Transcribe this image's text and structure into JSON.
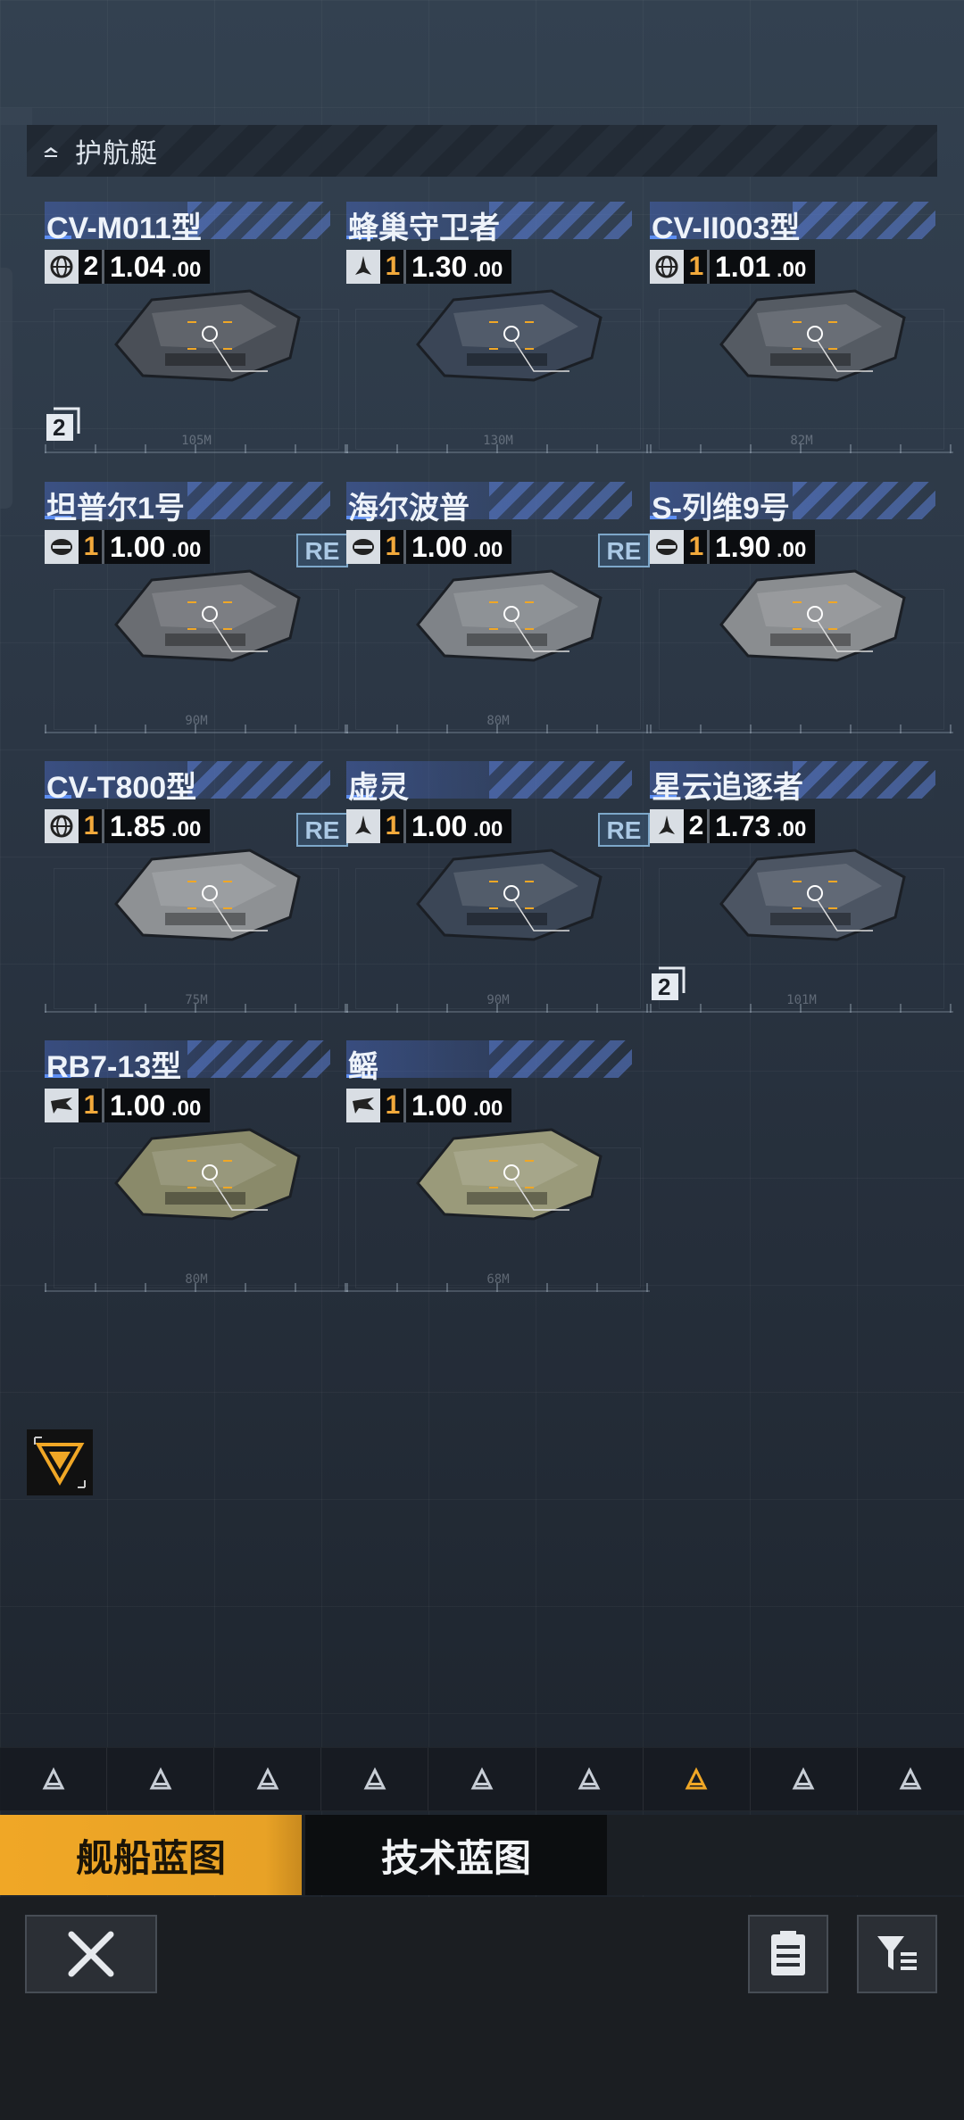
{
  "section": {
    "title": "护航艇",
    "icon": "escort-ship-icon"
  },
  "ships": [
    {
      "name": "CV-M011型",
      "type_icon": "globe-icon",
      "tier": "2",
      "value": "1.04",
      "decimals": "00",
      "re": false,
      "count": "2",
      "scale": "105M"
    },
    {
      "name": "蜂巢守卫者",
      "type_icon": "missile-icon",
      "tier": "1",
      "value": "1.30",
      "decimals": "00",
      "re": false,
      "count": "",
      "scale": "130M"
    },
    {
      "name": "CV-II003型",
      "type_icon": "globe-icon",
      "tier": "1",
      "value": "1.01",
      "decimals": "00",
      "re": false,
      "count": "",
      "scale": "82M"
    },
    {
      "name": "坦普尔1号",
      "type_icon": "shield-icon",
      "tier": "1",
      "value": "1.00",
      "decimals": "00",
      "re": true,
      "count": "",
      "scale": "90M"
    },
    {
      "name": "海尔波普",
      "type_icon": "shield-icon",
      "tier": "1",
      "value": "1.00",
      "decimals": "00",
      "re": true,
      "count": "",
      "scale": "80M"
    },
    {
      "name": "S-列维9号",
      "type_icon": "shield-icon",
      "tier": "1",
      "value": "1.90",
      "decimals": "00",
      "re": false,
      "count": "",
      "scale": ""
    },
    {
      "name": "CV-T800型",
      "type_icon": "globe-icon",
      "tier": "1",
      "value": "1.85",
      "decimals": "00",
      "re": true,
      "count": "",
      "scale": "75M"
    },
    {
      "name": "虚灵",
      "type_icon": "missile-icon",
      "tier": "1",
      "value": "1.00",
      "decimals": "00",
      "re": true,
      "count": "",
      "scale": "90M"
    },
    {
      "name": "星云追逐者",
      "type_icon": "missile-icon",
      "tier": "2",
      "value": "1.73",
      "decimals": "00",
      "re": false,
      "count": "2",
      "scale": "101M"
    },
    {
      "name": "RB7-13型",
      "type_icon": "wing-icon",
      "tier": "1",
      "value": "1.00",
      "decimals": "00",
      "re": false,
      "count": "",
      "scale": "80M"
    },
    {
      "name": "鳐",
      "type_icon": "wing-icon",
      "tier": "1",
      "value": "1.00",
      "decimals": "00",
      "re": false,
      "count": "",
      "scale": "68M"
    }
  ],
  "re_label": "RE",
  "type_nav": [
    "station-icon",
    "carrier-icon",
    "battlecruiser-icon",
    "cruiser-icon",
    "destroyer-icon",
    "frigate-icon",
    "escort-ship-icon",
    "fighter-group-icon",
    "other-icon"
  ],
  "type_nav_active": 6,
  "tabs": {
    "ship_blueprints": "舰船蓝图",
    "tech_blueprints": "技术蓝图"
  },
  "colors": {
    "accent": "#f0a726",
    "name_bar": "#4664b4",
    "re_border": "#7da7c9"
  }
}
